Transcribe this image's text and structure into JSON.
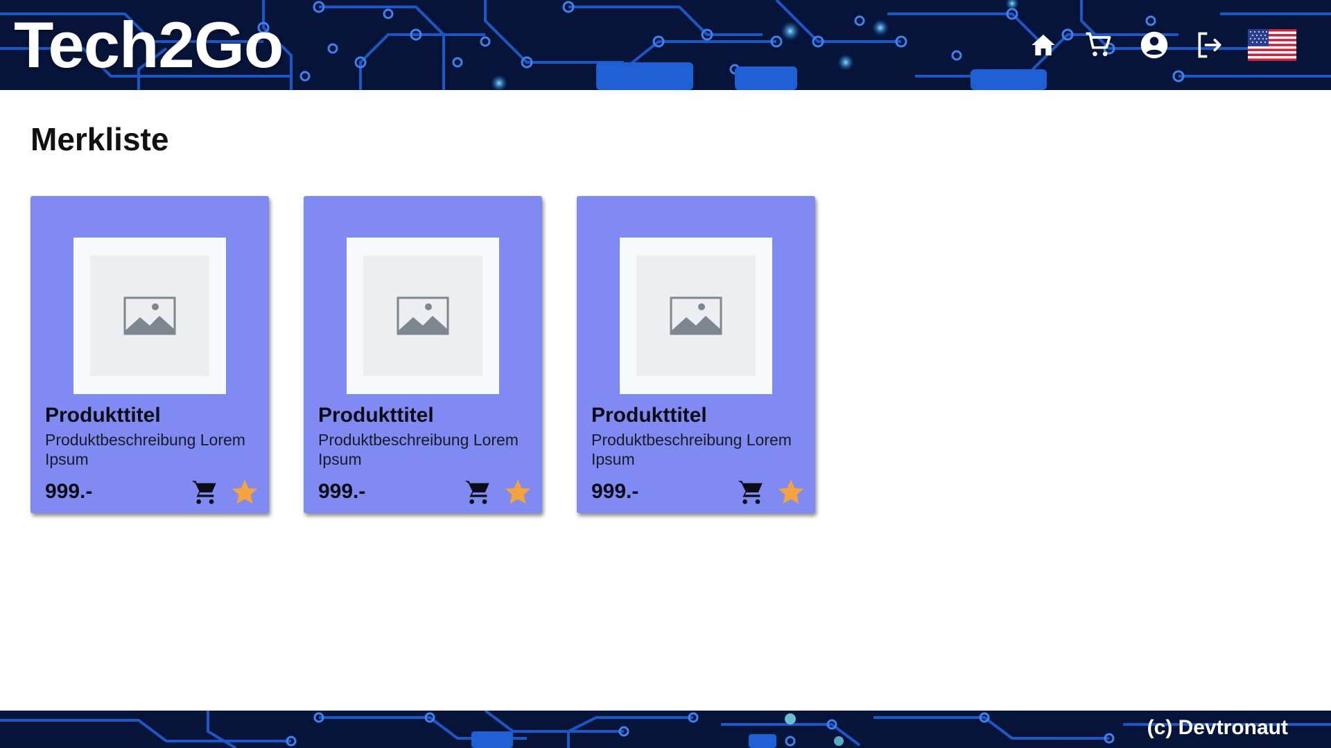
{
  "header": {
    "brand": "Tech2Go",
    "nav": [
      {
        "name": "home-icon"
      },
      {
        "name": "cart-icon"
      },
      {
        "name": "account-icon"
      },
      {
        "name": "logout-icon"
      },
      {
        "name": "us-flag-icon"
      }
    ]
  },
  "main": {
    "title": "Merkliste",
    "products": [
      {
        "title": "Produkttitel",
        "description": "Produktbeschreibung Lorem Ipsum",
        "price": "999.-"
      },
      {
        "title": "Produkttitel",
        "description": "Produktbeschreibung Lorem Ipsum",
        "price": "999.-"
      },
      {
        "title": "Produkttitel",
        "description": "Produktbeschreibung Lorem Ipsum",
        "price": "999.-"
      }
    ]
  },
  "footer": {
    "copyright": "(c) Devtronaut"
  },
  "colors": {
    "banner": "#06143a",
    "circuit": "#1f5fd6",
    "card": "#7f8af2",
    "star": "#f5a33a"
  }
}
